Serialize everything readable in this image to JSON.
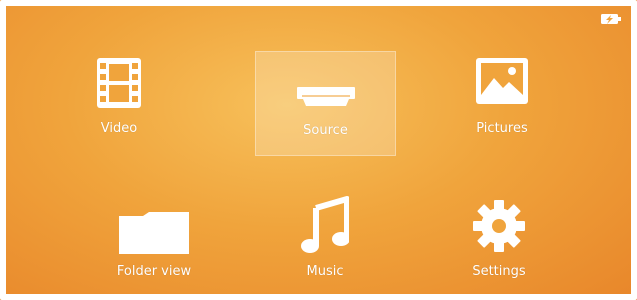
{
  "menu": {
    "items": [
      {
        "label": "Video",
        "icon": "film-icon"
      },
      {
        "label": "Source",
        "icon": "hdmi-icon"
      },
      {
        "label": "Pictures",
        "icon": "picture-icon"
      },
      {
        "label": "Folder view",
        "icon": "folder-icon"
      },
      {
        "label": "Music",
        "icon": "music-note-icon"
      },
      {
        "label": "Settings",
        "icon": "gear-icon"
      }
    ],
    "selected_index": 1
  },
  "status": {
    "battery_icon": "battery-charging-icon"
  },
  "colors": {
    "accent": "#f0a43c",
    "tile_fg": "#ffffff"
  }
}
